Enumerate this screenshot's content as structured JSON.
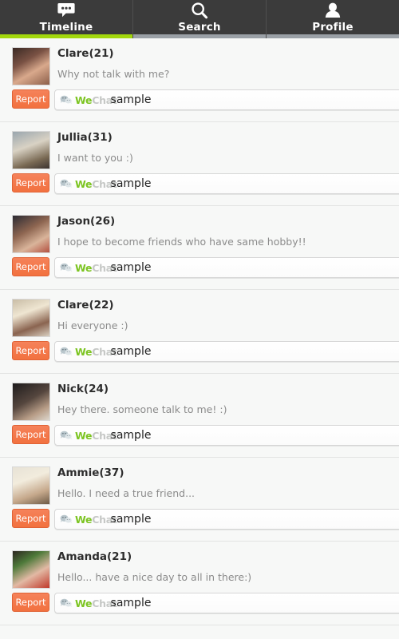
{
  "tabs": [
    {
      "label": "Timeline",
      "icon": "speech-bubble-icon",
      "active": true
    },
    {
      "label": "Search",
      "icon": "search-icon",
      "active": false
    },
    {
      "label": "Profile",
      "icon": "person-icon",
      "active": false
    }
  ],
  "colors": {
    "accent_green": "#a2d70c",
    "report_orange": "#f4784c",
    "tabbar_dark": "#3b3b3b",
    "wechat_green": "#7cc421",
    "wechat_gray": "#c6c8c6"
  },
  "ad": {
    "brand_we": "We",
    "brand_chat": "Chat",
    "sample_text": "sample",
    "logo_icon": "wechat-bubbles-icon"
  },
  "report_label": "Report",
  "posts": [
    {
      "name": "Clare(21)",
      "message": "Why not talk with me?",
      "avatar": "avatar-clare-21"
    },
    {
      "name": "Jullia(31)",
      "message": "I want to you :)",
      "avatar": "avatar-jullia-31"
    },
    {
      "name": "Jason(26)",
      "message": "I hope to become friends who have same hobby!!",
      "avatar": "avatar-jason-26"
    },
    {
      "name": "Clare(22)",
      "message": "Hi everyone  :)",
      "avatar": "avatar-clare-22"
    },
    {
      "name": "Nick(24)",
      "message": "Hey there. someone talk to me! :)",
      "avatar": "avatar-nick-24"
    },
    {
      "name": "Ammie(37)",
      "message": "Hello. I need a true friend...",
      "avatar": "avatar-ammie-37"
    },
    {
      "name": "Amanda(21)",
      "message": "Hello... have a nice day to all in there:)",
      "avatar": "avatar-amanda-21"
    }
  ]
}
